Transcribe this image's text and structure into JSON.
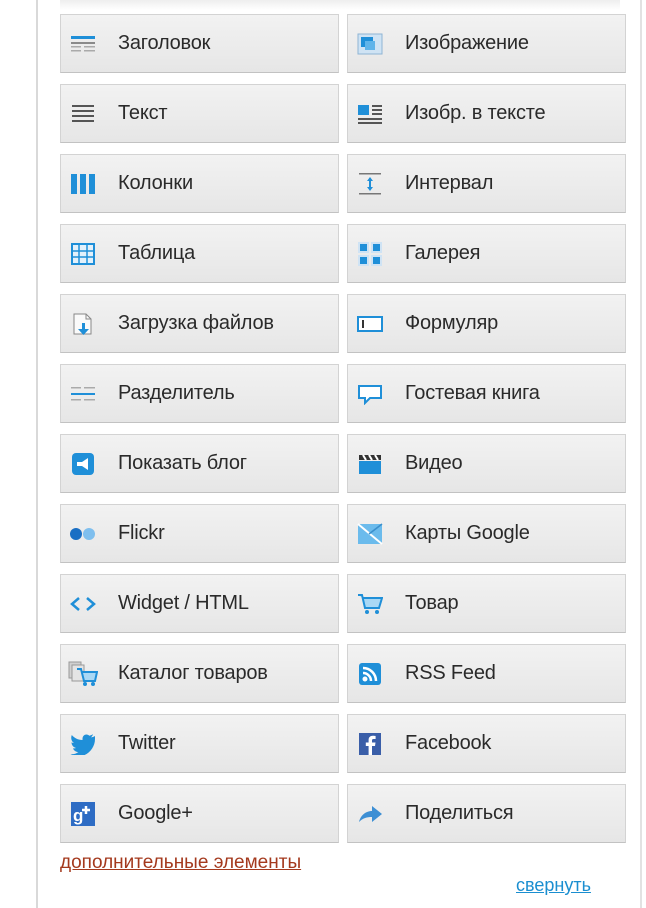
{
  "elements": [
    {
      "name": "element-heading",
      "icon": "heading-icon",
      "label": "Заголовок"
    },
    {
      "name": "element-image",
      "icon": "image-icon",
      "label": "Изображение"
    },
    {
      "name": "element-text",
      "icon": "text-icon",
      "label": "Текст"
    },
    {
      "name": "element-image-in-text",
      "icon": "image-in-text-icon",
      "label": "Изобр. в тексте"
    },
    {
      "name": "element-columns",
      "icon": "columns-icon",
      "label": "Колонки"
    },
    {
      "name": "element-spacing",
      "icon": "spacing-icon",
      "label": "Интервал"
    },
    {
      "name": "element-table",
      "icon": "table-icon",
      "label": "Таблица"
    },
    {
      "name": "element-gallery",
      "icon": "gallery-icon",
      "label": "Галерея"
    },
    {
      "name": "element-file-upload",
      "icon": "file-upload-icon",
      "label": "Загрузка файлов"
    },
    {
      "name": "element-form",
      "icon": "form-icon",
      "label": "Формуляр"
    },
    {
      "name": "element-divider",
      "icon": "divider-icon",
      "label": "Разделитель"
    },
    {
      "name": "element-guestbook",
      "icon": "guestbook-icon",
      "label": "Гостевая книга"
    },
    {
      "name": "element-show-blog",
      "icon": "blog-icon",
      "label": "Показать блог"
    },
    {
      "name": "element-video",
      "icon": "video-icon",
      "label": "Видео"
    },
    {
      "name": "element-flickr",
      "icon": "flickr-icon",
      "label": "Flickr"
    },
    {
      "name": "element-google-maps",
      "icon": "map-icon",
      "label": "Карты Google"
    },
    {
      "name": "element-widget-html",
      "icon": "code-icon",
      "label": "Widget / HTML"
    },
    {
      "name": "element-product",
      "icon": "cart-icon",
      "label": "Товар"
    },
    {
      "name": "element-product-catalog",
      "icon": "catalog-icon",
      "label": "Каталог товаров"
    },
    {
      "name": "element-rss-feed",
      "icon": "rss-icon",
      "label": "RSS Feed"
    },
    {
      "name": "element-twitter",
      "icon": "twitter-icon",
      "label": "Twitter"
    },
    {
      "name": "element-facebook",
      "icon": "facebook-icon",
      "label": "Facebook"
    },
    {
      "name": "element-google-plus",
      "icon": "google-plus-icon",
      "label": "Google+"
    },
    {
      "name": "element-share",
      "icon": "share-icon",
      "label": "Поделиться"
    }
  ],
  "footer": {
    "more_label": "дополнительные элементы",
    "collapse_label": "свернуть"
  },
  "colors": {
    "icon_blue": "#1f8fd8",
    "link_brown": "#a4391d",
    "link_blue": "#1a8ed0"
  }
}
